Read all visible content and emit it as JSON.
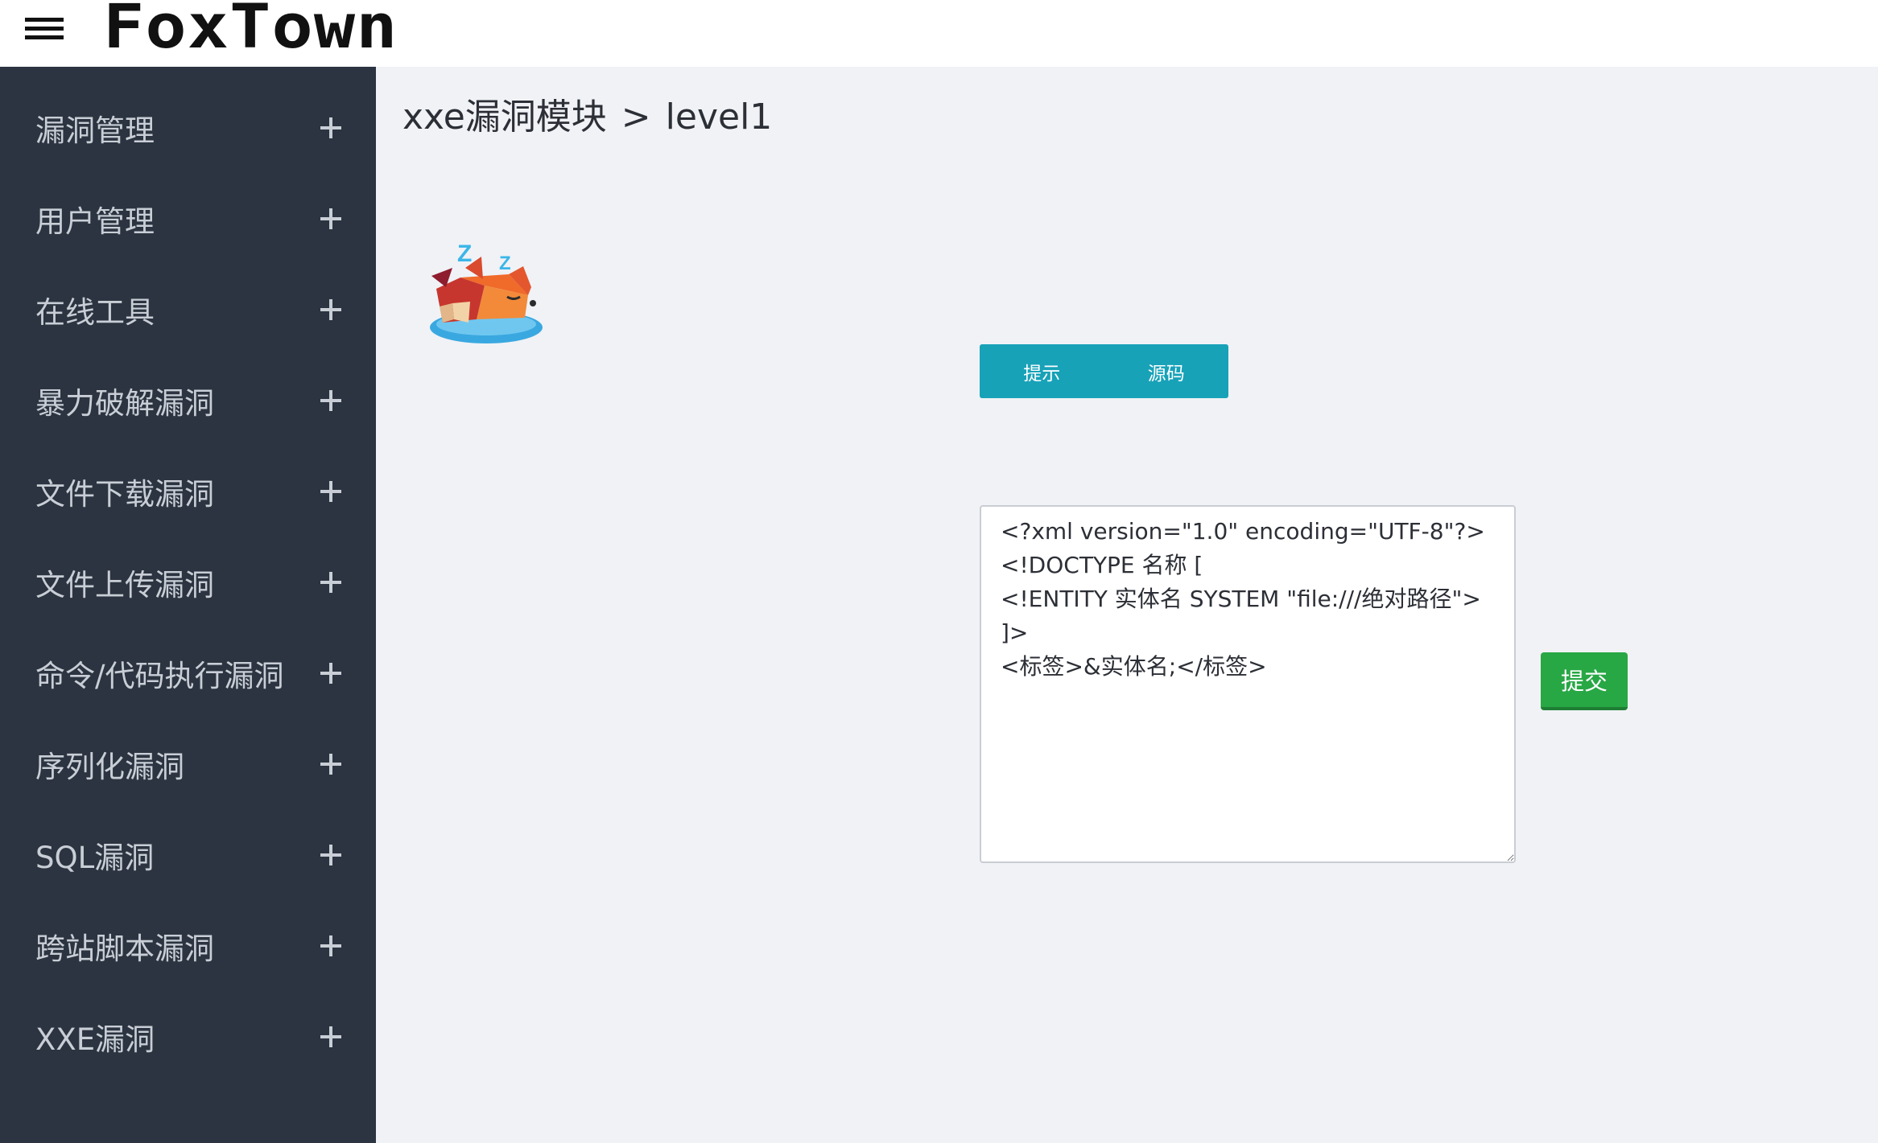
{
  "header": {
    "logo_text": "FoxTown",
    "menu_icon": "hamburger-icon"
  },
  "sidebar": {
    "items": [
      {
        "label": "漏洞管理",
        "icon": "plus-icon"
      },
      {
        "label": "用户管理",
        "icon": "plus-icon"
      },
      {
        "label": "在线工具",
        "icon": "plus-icon"
      },
      {
        "label": "暴力破解漏洞",
        "icon": "plus-icon"
      },
      {
        "label": "文件下载漏洞",
        "icon": "plus-icon"
      },
      {
        "label": "文件上传漏洞",
        "icon": "plus-icon"
      },
      {
        "label": "命令/代码执行漏洞",
        "icon": "plus-icon"
      },
      {
        "label": "序列化漏洞",
        "icon": "plus-icon"
      },
      {
        "label": "SQL漏洞",
        "icon": "plus-icon"
      },
      {
        "label": "跨站脚本漏洞",
        "icon": "plus-icon"
      },
      {
        "label": "XXE漏洞",
        "icon": "plus-icon"
      }
    ]
  },
  "main": {
    "breadcrumb": {
      "module": "xxe漏洞模块",
      "separator": ">",
      "level": "level1"
    },
    "illustration": "sleeping-fox-icon",
    "buttons": {
      "hint_label": "提示",
      "source_label": "源码"
    },
    "xml_input": {
      "value": "<?xml version=\"1.0\" encoding=\"UTF-8\"?>\n<!DOCTYPE 名称 [\n<!ENTITY 实体名 SYSTEM \"file:///绝对路径\">\n]>\n<标签>&实体名;</标签>"
    },
    "submit_label": "提交"
  },
  "colors": {
    "sidebar_bg": "#2b3440",
    "page_bg": "#f0f2f6",
    "info_button": "#17a2b8",
    "submit_button": "#28a745"
  }
}
